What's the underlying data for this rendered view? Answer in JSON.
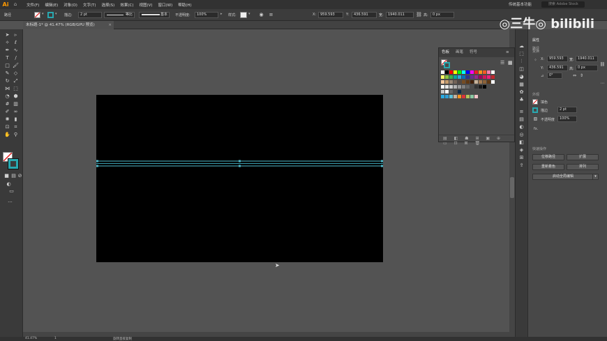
{
  "app": {
    "logo": "Ai"
  },
  "menu": [
    "文件(F)",
    "编辑(E)",
    "对象(O)",
    "文字(T)",
    "选择(S)",
    "效果(C)",
    "视图(V)",
    "窗口(W)",
    "帮助(H)"
  ],
  "workspace": "传统基本功能",
  "search": {
    "placeholder": "搜索 Adobe Stock"
  },
  "control_bar": {
    "selection_label": "路径",
    "stroke_label": "描边:",
    "stroke_weight": "2 pt",
    "brush_label": "等比",
    "style_label": "基本",
    "opacity_label": "不透明度:",
    "opacity_value": "100%",
    "style2_label": "样式:",
    "x_label": "X:",
    "x_value": "959.593",
    "y_label": "Y:",
    "y_value": "436.591",
    "w_label": "宽:",
    "w_value": "1940.011",
    "h_label": "高:",
    "h_value": "0 px"
  },
  "document_tab": {
    "title": "未标题-1* @ 41.47% (RGB/GPU 预览)"
  },
  "swatches_panel": {
    "tabs": [
      "色板",
      "画笔",
      "符号"
    ],
    "colors": {
      "fill": "#ffffff",
      "stroke": "#28a8b0"
    }
  },
  "properties_panel": {
    "title": "属性",
    "section_path": "路径",
    "section_transform": "变换",
    "x": "959.593",
    "y": "436.591",
    "w": "1940.011",
    "h": "0 px",
    "angle": "0°",
    "section_appearance": "外观",
    "fill_label": "填色",
    "stroke_label": "描边",
    "stroke_value": "2 pt",
    "opacity_label": "不透明度",
    "opacity_value": "100%",
    "fx_label": "fx.",
    "section_quick": "快速操作",
    "btn_offset": "位移路径",
    "btn_expand": "扩展",
    "btn_recolor": "重新着色",
    "btn_arrange": "排列",
    "btn_global": "启动全局编辑"
  },
  "status_bar": {
    "zoom": "41.47%",
    "page": "1",
    "tool_status": "旋转直接复制"
  },
  "watermark": "◎三牛◎ bilibili"
}
